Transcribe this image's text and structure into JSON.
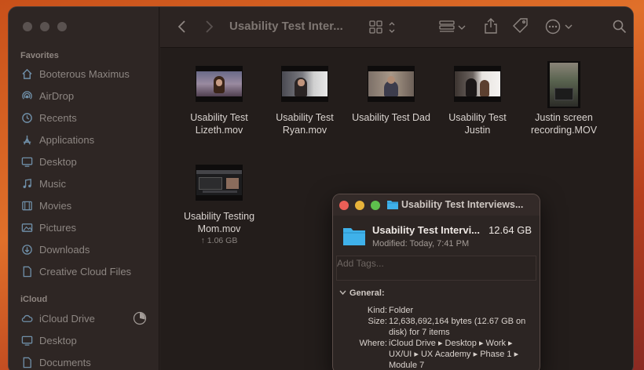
{
  "sidebar": {
    "favorites_title": "Favorites",
    "favorites": [
      {
        "label": "Booterous Maximus",
        "icon": "house-icon"
      },
      {
        "label": "AirDrop",
        "icon": "airdrop-icon"
      },
      {
        "label": "Recents",
        "icon": "clock-icon"
      },
      {
        "label": "Applications",
        "icon": "applications-icon"
      },
      {
        "label": "Desktop",
        "icon": "desktop-icon"
      },
      {
        "label": "Music",
        "icon": "music-icon"
      },
      {
        "label": "Movies",
        "icon": "movies-icon"
      },
      {
        "label": "Pictures",
        "icon": "pictures-icon"
      },
      {
        "label": "Downloads",
        "icon": "downloads-icon"
      },
      {
        "label": "Creative Cloud Files",
        "icon": "document-icon"
      }
    ],
    "icloud_title": "iCloud",
    "icloud": [
      {
        "label": "iCloud Drive",
        "icon": "cloud-icon"
      },
      {
        "label": "Desktop",
        "icon": "desktop-icon"
      },
      {
        "label": "Documents",
        "icon": "document-icon"
      }
    ]
  },
  "toolbar": {
    "title": "Usability Test Inter..."
  },
  "files": [
    {
      "line1": "Usability Test",
      "line2": "Lizeth.mov",
      "size": ""
    },
    {
      "line1": "Usability Test",
      "line2": "Ryan.mov",
      "size": ""
    },
    {
      "line1": "Usability Test Dad",
      "line2": "",
      "size": ""
    },
    {
      "line1": "Usability Test",
      "line2": "Justin",
      "size": ""
    },
    {
      "line1": "Justin screen",
      "line2": "recording.MOV",
      "size": ""
    },
    {
      "line1": "Usability Testing",
      "line2": "Mom.mov",
      "size": "↑ 1.06 GB"
    }
  ],
  "info": {
    "window_title": "Usability Test Interviews...",
    "name": "Usability Test Intervi...",
    "size": "12.64 GB",
    "modified": "Modified: Today, 7:41 PM",
    "tags_placeholder": "Add Tags...",
    "section": "General:",
    "kind_k": "Kind:",
    "kind_v": "Folder",
    "size_k": "Size:",
    "size_v": "12,638,692,164 bytes (12.67 GB on disk) for 7 items",
    "where_k": "Where:",
    "where_v": "iCloud Drive ▸ Desktop ▸ Work ▸ UX/UI ▸ UX Academy ▸ Phase 1 ▸ Module 7"
  },
  "colors": {
    "folder_blue": "#3fb1ea",
    "close": "#ec5f57",
    "minimize": "#e8b33a",
    "zoom": "#5ec04d"
  }
}
